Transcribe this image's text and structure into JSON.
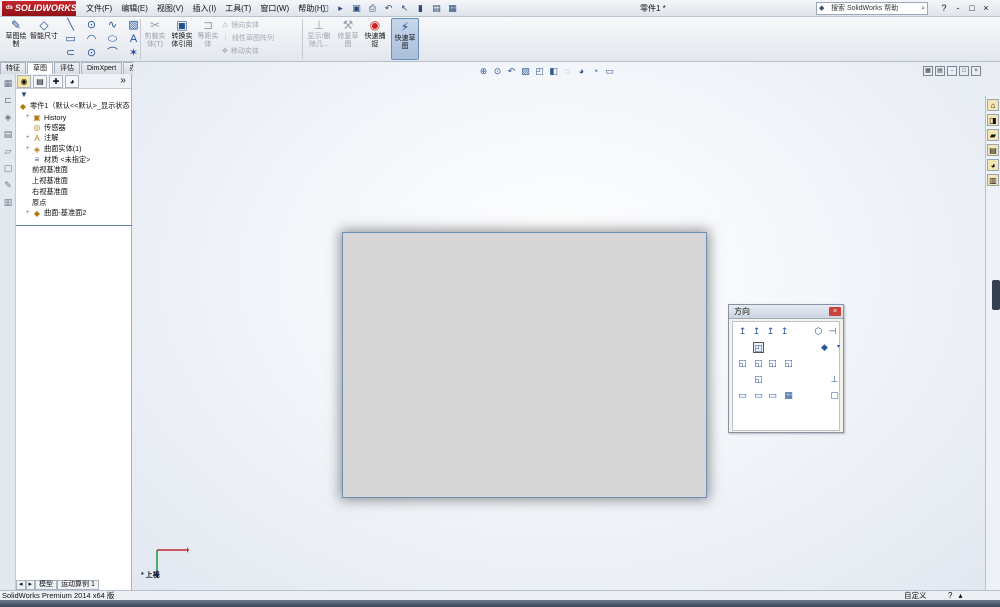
{
  "app": {
    "logo": "SOLIDWORKS",
    "document_title": "零件1 *",
    "menu": [
      "文件(F)",
      "编辑(E)",
      "视图(V)",
      "插入(I)",
      "工具(T)",
      "窗口(W)",
      "帮助(H)"
    ],
    "search_placeholder": "搜索 SolidWorks 帮助",
    "window_controls": [
      "?",
      "-",
      "□",
      "×"
    ]
  },
  "ribbon": {
    "sketch_draw": "草图绘制",
    "smart_dim": "智能尺寸",
    "trim": "剪裁实体(T)",
    "convert": "转换实体引用",
    "offset": "等距实体",
    "mirror": "镜向实体",
    "linear_pattern": "线性草图阵列",
    "move": "移动实体",
    "display_delete": "显示/删除几...",
    "repair": "修复草图",
    "quick_snap": "快速捕捉",
    "rapid_sketch": "快速草图"
  },
  "tabs": [
    "特征",
    "草图",
    "评估",
    "DimXpert",
    "办公室产品"
  ],
  "feature_tree": {
    "root": "零件1（默认<<默认>_显示状态",
    "nodes": [
      {
        "label": "History",
        "icon": "history-icon",
        "expand": "+"
      },
      {
        "label": "传感器",
        "icon": "sensor-icon",
        "expand": ""
      },
      {
        "label": "注解",
        "icon": "annotation-icon",
        "expand": "+"
      },
      {
        "label": "曲面实体(1)",
        "icon": "surface-body-icon",
        "expand": "+"
      },
      {
        "label": "材质 <未指定>",
        "icon": "material-icon",
        "expand": ""
      },
      {
        "label": "前视基准面",
        "icon": "plane-icon",
        "expand": ""
      },
      {
        "label": "上视基准面",
        "icon": "plane-icon",
        "expand": ""
      },
      {
        "label": "右视基准面",
        "icon": "plane-icon",
        "expand": ""
      },
      {
        "label": "原点",
        "icon": "origin-icon",
        "expand": ""
      },
      {
        "label": "曲面-基准面2",
        "icon": "surface-plane-icon",
        "expand": "+"
      }
    ],
    "bottom_tabs": [
      "模型",
      "运动算例 1"
    ]
  },
  "graphics": {
    "view_label": "* 上视"
  },
  "orientation_dialog": {
    "title": "方向"
  },
  "status": {
    "left": "SolidWorks Premium 2014 x64 版",
    "custom": "自定义"
  },
  "colors": {
    "brand": "#b01e23",
    "plane_fill": "#d6d6d6",
    "plane_border": "#6f8fb6",
    "active_tool": "#a9bfdc"
  }
}
